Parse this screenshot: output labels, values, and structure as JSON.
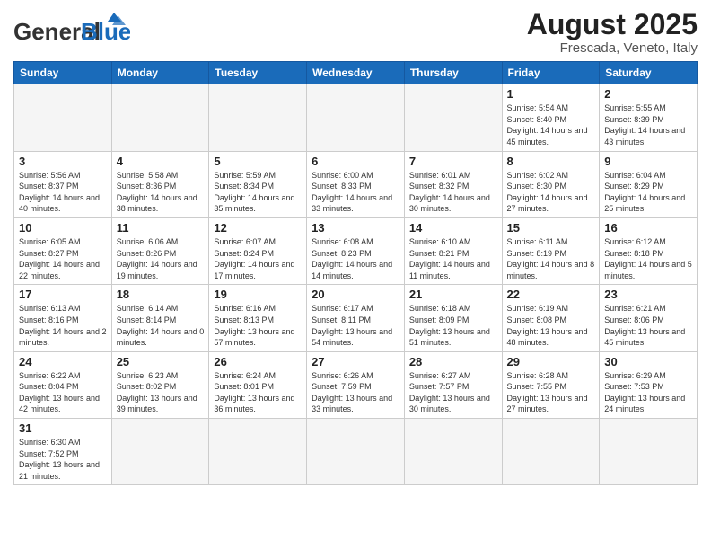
{
  "header": {
    "logo_general": "General",
    "logo_blue": "Blue",
    "main_title": "August 2025",
    "sub_title": "Frescada, Veneto, Italy"
  },
  "weekdays": [
    "Sunday",
    "Monday",
    "Tuesday",
    "Wednesday",
    "Thursday",
    "Friday",
    "Saturday"
  ],
  "weeks": [
    [
      {
        "date": "",
        "info": ""
      },
      {
        "date": "",
        "info": ""
      },
      {
        "date": "",
        "info": ""
      },
      {
        "date": "",
        "info": ""
      },
      {
        "date": "",
        "info": ""
      },
      {
        "date": "1",
        "info": "Sunrise: 5:54 AM\nSunset: 8:40 PM\nDaylight: 14 hours\nand 45 minutes."
      },
      {
        "date": "2",
        "info": "Sunrise: 5:55 AM\nSunset: 8:39 PM\nDaylight: 14 hours\nand 43 minutes."
      }
    ],
    [
      {
        "date": "3",
        "info": "Sunrise: 5:56 AM\nSunset: 8:37 PM\nDaylight: 14 hours\nand 40 minutes."
      },
      {
        "date": "4",
        "info": "Sunrise: 5:58 AM\nSunset: 8:36 PM\nDaylight: 14 hours\nand 38 minutes."
      },
      {
        "date": "5",
        "info": "Sunrise: 5:59 AM\nSunset: 8:34 PM\nDaylight: 14 hours\nand 35 minutes."
      },
      {
        "date": "6",
        "info": "Sunrise: 6:00 AM\nSunset: 8:33 PM\nDaylight: 14 hours\nand 33 minutes."
      },
      {
        "date": "7",
        "info": "Sunrise: 6:01 AM\nSunset: 8:32 PM\nDaylight: 14 hours\nand 30 minutes."
      },
      {
        "date": "8",
        "info": "Sunrise: 6:02 AM\nSunset: 8:30 PM\nDaylight: 14 hours\nand 27 minutes."
      },
      {
        "date": "9",
        "info": "Sunrise: 6:04 AM\nSunset: 8:29 PM\nDaylight: 14 hours\nand 25 minutes."
      }
    ],
    [
      {
        "date": "10",
        "info": "Sunrise: 6:05 AM\nSunset: 8:27 PM\nDaylight: 14 hours\nand 22 minutes."
      },
      {
        "date": "11",
        "info": "Sunrise: 6:06 AM\nSunset: 8:26 PM\nDaylight: 14 hours\nand 19 minutes."
      },
      {
        "date": "12",
        "info": "Sunrise: 6:07 AM\nSunset: 8:24 PM\nDaylight: 14 hours\nand 17 minutes."
      },
      {
        "date": "13",
        "info": "Sunrise: 6:08 AM\nSunset: 8:23 PM\nDaylight: 14 hours\nand 14 minutes."
      },
      {
        "date": "14",
        "info": "Sunrise: 6:10 AM\nSunset: 8:21 PM\nDaylight: 14 hours\nand 11 minutes."
      },
      {
        "date": "15",
        "info": "Sunrise: 6:11 AM\nSunset: 8:19 PM\nDaylight: 14 hours\nand 8 minutes."
      },
      {
        "date": "16",
        "info": "Sunrise: 6:12 AM\nSunset: 8:18 PM\nDaylight: 14 hours\nand 5 minutes."
      }
    ],
    [
      {
        "date": "17",
        "info": "Sunrise: 6:13 AM\nSunset: 8:16 PM\nDaylight: 14 hours\nand 2 minutes."
      },
      {
        "date": "18",
        "info": "Sunrise: 6:14 AM\nSunset: 8:14 PM\nDaylight: 14 hours\nand 0 minutes."
      },
      {
        "date": "19",
        "info": "Sunrise: 6:16 AM\nSunset: 8:13 PM\nDaylight: 13 hours\nand 57 minutes."
      },
      {
        "date": "20",
        "info": "Sunrise: 6:17 AM\nSunset: 8:11 PM\nDaylight: 13 hours\nand 54 minutes."
      },
      {
        "date": "21",
        "info": "Sunrise: 6:18 AM\nSunset: 8:09 PM\nDaylight: 13 hours\nand 51 minutes."
      },
      {
        "date": "22",
        "info": "Sunrise: 6:19 AM\nSunset: 8:08 PM\nDaylight: 13 hours\nand 48 minutes."
      },
      {
        "date": "23",
        "info": "Sunrise: 6:21 AM\nSunset: 8:06 PM\nDaylight: 13 hours\nand 45 minutes."
      }
    ],
    [
      {
        "date": "24",
        "info": "Sunrise: 6:22 AM\nSunset: 8:04 PM\nDaylight: 13 hours\nand 42 minutes."
      },
      {
        "date": "25",
        "info": "Sunrise: 6:23 AM\nSunset: 8:02 PM\nDaylight: 13 hours\nand 39 minutes."
      },
      {
        "date": "26",
        "info": "Sunrise: 6:24 AM\nSunset: 8:01 PM\nDaylight: 13 hours\nand 36 minutes."
      },
      {
        "date": "27",
        "info": "Sunrise: 6:26 AM\nSunset: 7:59 PM\nDaylight: 13 hours\nand 33 minutes."
      },
      {
        "date": "28",
        "info": "Sunrise: 6:27 AM\nSunset: 7:57 PM\nDaylight: 13 hours\nand 30 minutes."
      },
      {
        "date": "29",
        "info": "Sunrise: 6:28 AM\nSunset: 7:55 PM\nDaylight: 13 hours\nand 27 minutes."
      },
      {
        "date": "30",
        "info": "Sunrise: 6:29 AM\nSunset: 7:53 PM\nDaylight: 13 hours\nand 24 minutes."
      }
    ],
    [
      {
        "date": "31",
        "info": "Sunrise: 6:30 AM\nSunset: 7:52 PM\nDaylight: 13 hours\nand 21 minutes."
      },
      {
        "date": "",
        "info": ""
      },
      {
        "date": "",
        "info": ""
      },
      {
        "date": "",
        "info": ""
      },
      {
        "date": "",
        "info": ""
      },
      {
        "date": "",
        "info": ""
      },
      {
        "date": "",
        "info": ""
      }
    ]
  ]
}
